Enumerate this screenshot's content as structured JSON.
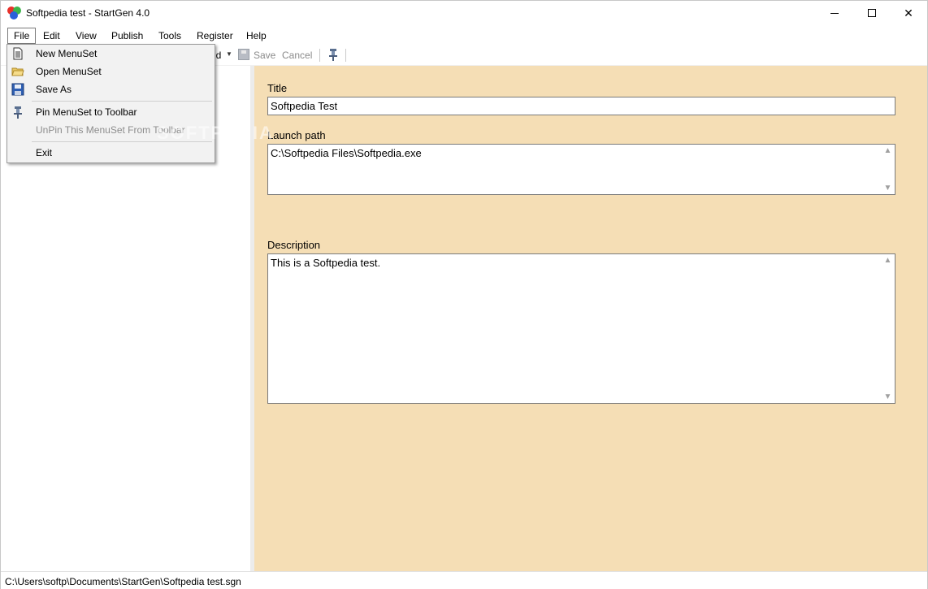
{
  "window": {
    "title": "Softpedia test - StartGen 4.0",
    "buttons": {
      "minimize": "—",
      "maximize": "☐",
      "close": "✕"
    }
  },
  "menubar": {
    "items": [
      {
        "label": "File"
      },
      {
        "label": "Edit"
      },
      {
        "label": "View"
      },
      {
        "label": "Publish"
      },
      {
        "label": "Tools"
      },
      {
        "label": "Register"
      },
      {
        "label": "Help"
      }
    ]
  },
  "toolbar": {
    "add_label": "ld",
    "save_label": "Save",
    "cancel_label": "Cancel"
  },
  "file_menu": {
    "items": [
      {
        "label": "New MenuSet",
        "icon": "new-document-icon",
        "enabled": true
      },
      {
        "label": "Open MenuSet",
        "icon": "open-folder-icon",
        "enabled": true
      },
      {
        "label": "Save As",
        "icon": "floppy-disk-icon",
        "enabled": true
      },
      {
        "label": "Pin MenuSet to Toolbar",
        "icon": "pin-icon",
        "enabled": true
      },
      {
        "label": "UnPin This MenuSet From Toolbar",
        "icon": "",
        "enabled": false
      },
      {
        "label": "Exit",
        "icon": "",
        "enabled": true
      }
    ]
  },
  "form": {
    "title_label": "Title",
    "title_value": "Softpedia Test",
    "launch_label": "Launch path",
    "launch_value": "C:\\Softpedia Files\\Softpedia.exe",
    "description_label": "Description",
    "description_value": "This is a Softpedia test."
  },
  "status": {
    "path": "C:\\Users\\softp\\Documents\\StartGen\\Softpedia test.sgn"
  },
  "colors": {
    "right_panel_bg": "#f5deb5",
    "menu_bg": "#f2f2f2",
    "disabled_text": "#8d8d8d"
  },
  "watermark": "SOFTPEDIA"
}
